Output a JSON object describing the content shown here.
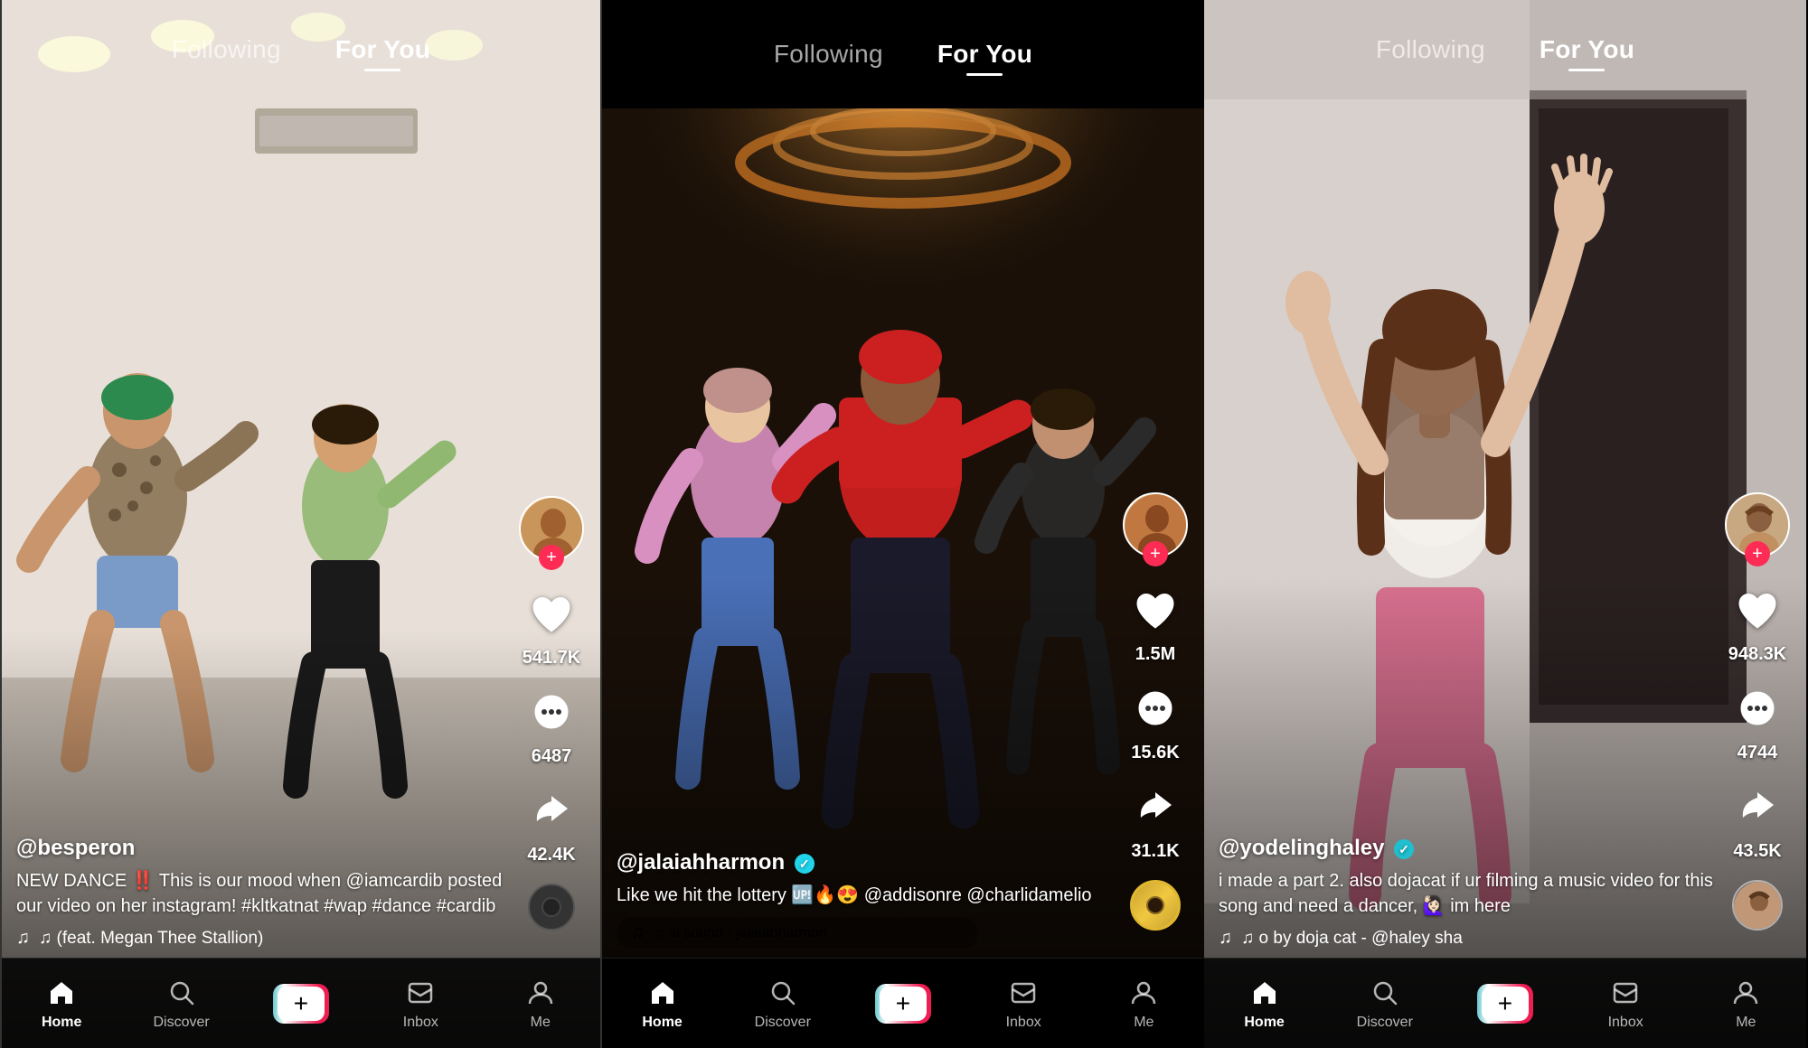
{
  "panels": [
    {
      "id": "panel1",
      "nav": {
        "following_label": "Following",
        "for_you_label": "For You",
        "active_tab": "for_you"
      },
      "video": {
        "username": "@besperon",
        "caption": "NEW DANCE ‼️ This is our mood when @iamcardib posted our video on her instagram! #kltkatnat #wap #dance #cardib",
        "music": "♫ (feat. Megan Thee Stallion)",
        "likes": "541.7K",
        "comments": "6487",
        "share": "42.4K"
      },
      "bottom_nav": {
        "home": "Home",
        "discover": "Discover",
        "inbox": "Inbox",
        "me": "Me"
      }
    },
    {
      "id": "panel2",
      "nav": {
        "following_label": "Following",
        "for_you_label": "For You",
        "active_tab": "for_you"
      },
      "video": {
        "username": "@jalaiahharmon",
        "verified": true,
        "caption": "Like we hit the lottery 🆙🔥😍 @addisonre @charlidamelio",
        "music": "♫ al sound - jalaiahharmon",
        "likes": "1.5M",
        "comments": "15.6K",
        "share": "31.1K"
      },
      "bottom_nav": {
        "home": "Home",
        "discover": "Discover",
        "inbox": "Inbox",
        "me": "Me"
      }
    },
    {
      "id": "panel3",
      "nav": {
        "following_label": "Following",
        "for_you_label": "For You",
        "active_tab": "for_you"
      },
      "video": {
        "username": "@yodelinghaley",
        "verified": true,
        "caption": "i made a part 2. also dojacat if ur filming a music video for this song and need a dancer, 🙋🏻‍♀️ im here",
        "music": "♫ o by doja cat - @haley sha",
        "likes": "948.3K",
        "comments": "4744",
        "share": "43.5K"
      },
      "bottom_nav": {
        "home": "Home",
        "discover": "Discover",
        "inbox": "Inbox",
        "me": "Me"
      }
    }
  ],
  "icons": {
    "home": "⌂",
    "search": "🔍",
    "plus": "+",
    "inbox": "💬",
    "profile": "👤",
    "heart": "♡",
    "comment": "💬",
    "share": "➤",
    "music_note": "♫",
    "verified_check": "✓"
  }
}
